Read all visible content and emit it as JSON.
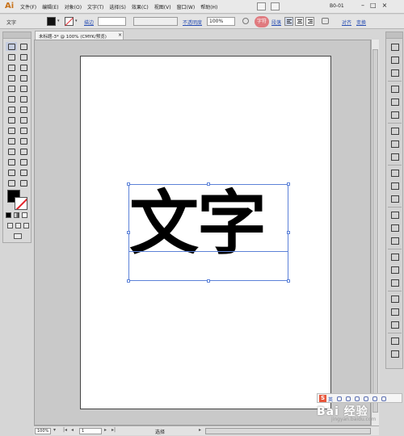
{
  "app": {
    "logo": "Ai"
  },
  "menubar": {
    "items": [
      "文件(F)",
      "编辑(E)",
      "对象(O)",
      "文字(T)",
      "选择(S)",
      "效果(C)",
      "视图(V)",
      "窗口(W)",
      "帮助(H)"
    ],
    "workspace": "B0-01",
    "window_buttons": [
      "–",
      "□",
      "×"
    ]
  },
  "controlbar": {
    "object_label": "文字",
    "stroke_label": "描边",
    "opacity_label": "不透明度",
    "opacity_value": "100%",
    "character_label": "字符",
    "paragraph_label": "段落",
    "align_label": "对齐",
    "transform_label": "变换"
  },
  "document": {
    "tab_title": "未标题-3* @ 100% (CMYK/预览)",
    "close": "×",
    "text_content": "文字"
  },
  "statusbar": {
    "zoom": "100%",
    "page": "1",
    "status": "选择"
  },
  "watermark": {
    "ime_logo": "S",
    "ime_mode": "英",
    "site_name": "Bai 经验",
    "site_url": "jingyan.baidu.com"
  },
  "colors": {
    "accent_highlight": "#e07a7f",
    "selection": "#5d82d8",
    "fill": "#000000"
  }
}
